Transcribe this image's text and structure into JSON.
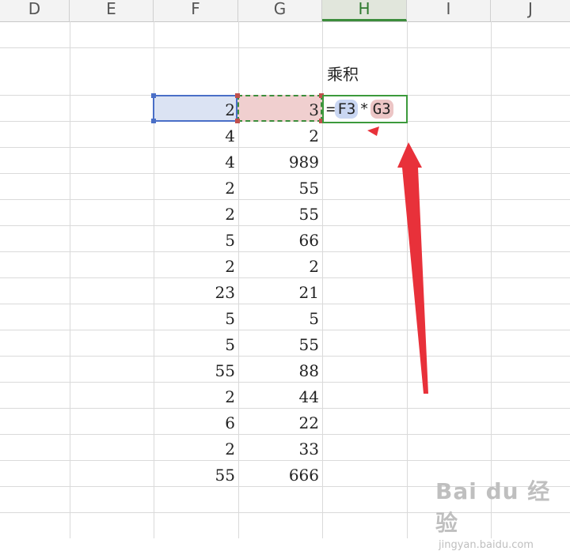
{
  "columns": [
    "D",
    "E",
    "F",
    "G",
    "H",
    "I",
    "J"
  ],
  "header_label": "乘积",
  "formula": {
    "eq": "=",
    "ref1": "F3",
    "op": "*",
    "ref2": "G3"
  },
  "rows": [
    {
      "f": "2",
      "g": "3"
    },
    {
      "f": "4",
      "g": "2"
    },
    {
      "f": "4",
      "g": "989"
    },
    {
      "f": "2",
      "g": "55"
    },
    {
      "f": "2",
      "g": "55"
    },
    {
      "f": "5",
      "g": "66"
    },
    {
      "f": "2",
      "g": "2"
    },
    {
      "f": "23",
      "g": "21"
    },
    {
      "f": "5",
      "g": "5"
    },
    {
      "f": "5",
      "g": "55"
    },
    {
      "f": "55",
      "g": "88"
    },
    {
      "f": "2",
      "g": "44"
    },
    {
      "f": "6",
      "g": "22"
    },
    {
      "f": "2",
      "g": "33"
    },
    {
      "f": "55",
      "g": "666"
    }
  ],
  "watermark": {
    "brand": "Bai du 经验",
    "url": "jingyan.baidu.com"
  },
  "colors": {
    "accent_green": "#3c8d3c",
    "ref_blue": "#4a6fc7",
    "arrow_red": "#e8313a"
  }
}
